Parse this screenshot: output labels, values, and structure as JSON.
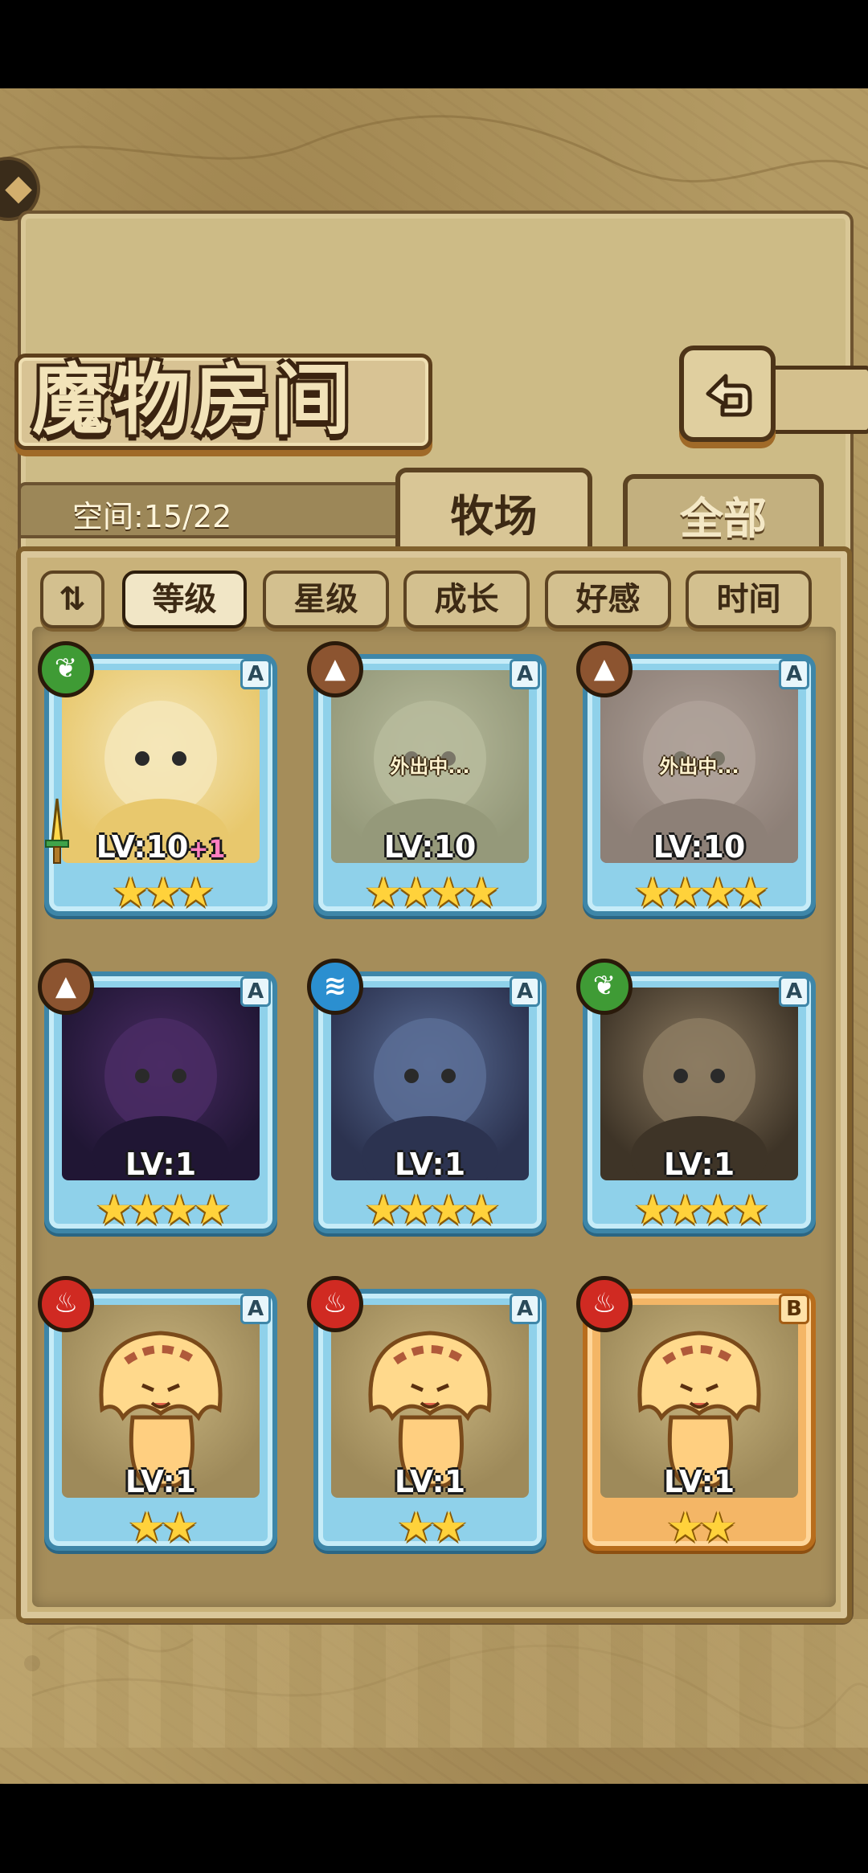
{
  "header": {
    "title": "魔物房间"
  },
  "storage": {
    "space_label": "空间:15/22"
  },
  "tabs": [
    {
      "label": "牧场",
      "active": true
    },
    {
      "label": "全部",
      "active": false
    }
  ],
  "filters": [
    {
      "label": "等级",
      "selected": true
    },
    {
      "label": "星级",
      "selected": false
    },
    {
      "label": "成长",
      "selected": false
    },
    {
      "label": "好感",
      "selected": false
    },
    {
      "label": "时间",
      "selected": false
    }
  ],
  "monsters": [
    {
      "element": "leaf-icon",
      "rank": "A",
      "level": "LV:10",
      "bonus": "+1",
      "stars": 3,
      "status": "",
      "frame": "blue",
      "equipped": true
    },
    {
      "element": "rock-icon",
      "rank": "A",
      "level": "LV:10",
      "bonus": "",
      "stars": 4,
      "status": "外出中...",
      "frame": "blue",
      "equipped": false
    },
    {
      "element": "rock-icon",
      "rank": "A",
      "level": "LV:10",
      "bonus": "",
      "stars": 4,
      "status": "外出中...",
      "frame": "blue",
      "equipped": false
    },
    {
      "element": "rock-icon",
      "rank": "A",
      "level": "LV:1",
      "bonus": "",
      "stars": 4,
      "status": "",
      "frame": "blue",
      "equipped": false
    },
    {
      "element": "water-icon",
      "rank": "A",
      "level": "LV:1",
      "bonus": "",
      "stars": 4,
      "status": "",
      "frame": "blue",
      "equipped": false
    },
    {
      "element": "leaf-icon",
      "rank": "A",
      "level": "LV:1",
      "bonus": "",
      "stars": 4,
      "status": "",
      "frame": "blue",
      "equipped": false
    },
    {
      "element": "fire-icon",
      "rank": "A",
      "level": "LV:1",
      "bonus": "",
      "stars": 2,
      "status": "",
      "frame": "blue",
      "equipped": false
    },
    {
      "element": "fire-icon",
      "rank": "A",
      "level": "LV:1",
      "bonus": "",
      "stars": 2,
      "status": "",
      "frame": "blue",
      "equipped": false
    },
    {
      "element": "fire-icon",
      "rank": "B",
      "level": "LV:1",
      "bonus": "",
      "stars": 2,
      "status": "",
      "frame": "orange",
      "equipped": false
    }
  ],
  "colors": {
    "parchment": "#cdbb86",
    "frame_blue": "#8fd1ea",
    "frame_orange": "#f4b666",
    "star": "#ffd23b"
  }
}
